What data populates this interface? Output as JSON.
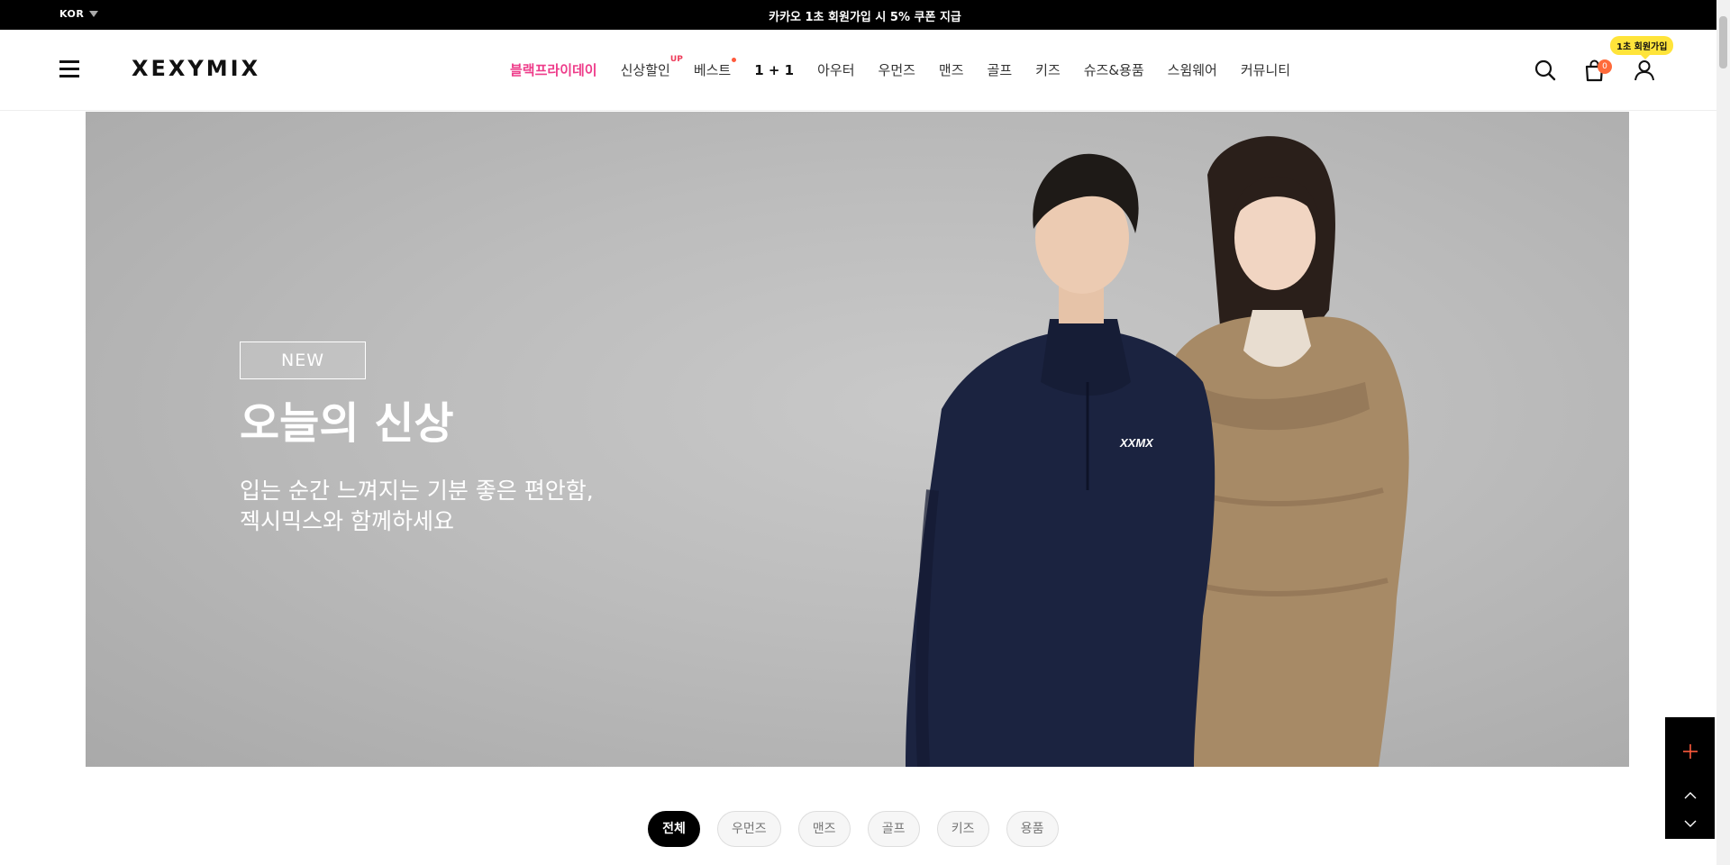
{
  "topbar": {
    "lang": "KOR",
    "promo": "카카오 1초 회원가입 시 5% 쿠폰 지급"
  },
  "header": {
    "logo": "XEXYMIX",
    "nav": [
      {
        "label": "블랙프라이데이"
      },
      {
        "label": "신상할인",
        "sup": "UP"
      },
      {
        "label": "베스트"
      },
      {
        "label": "1 + 1"
      },
      {
        "label": "아우터"
      },
      {
        "label": "우먼즈"
      },
      {
        "label": "맨즈"
      },
      {
        "label": "골프"
      },
      {
        "label": "키즈"
      },
      {
        "label": "슈즈&용품"
      },
      {
        "label": "스윔웨어"
      },
      {
        "label": "커뮤니티"
      }
    ],
    "cart_count": "0",
    "signup_tooltip": "1초 회원가입"
  },
  "hero": {
    "tag": "NEW",
    "title": "오늘의 신상",
    "subtitle_line1": "입는 순간 느껴지는 기분 좋은 편안함,",
    "subtitle_line2": "젝시믹스와 함께하세요",
    "jacket_logo": "XXMX"
  },
  "chips": [
    "전체",
    "우먼즈",
    "맨즈",
    "골프",
    "키즈",
    "용품"
  ],
  "colors": {
    "accent_pink": "#ee3c8a",
    "badge_orange": "#ff6a3a",
    "tooltip_yellow": "#ffe43a"
  },
  "icons": [
    "hamburger-icon",
    "search-icon",
    "cart-icon",
    "user-icon",
    "plus-icon",
    "chevron-up-icon",
    "chevron-down-icon"
  ]
}
